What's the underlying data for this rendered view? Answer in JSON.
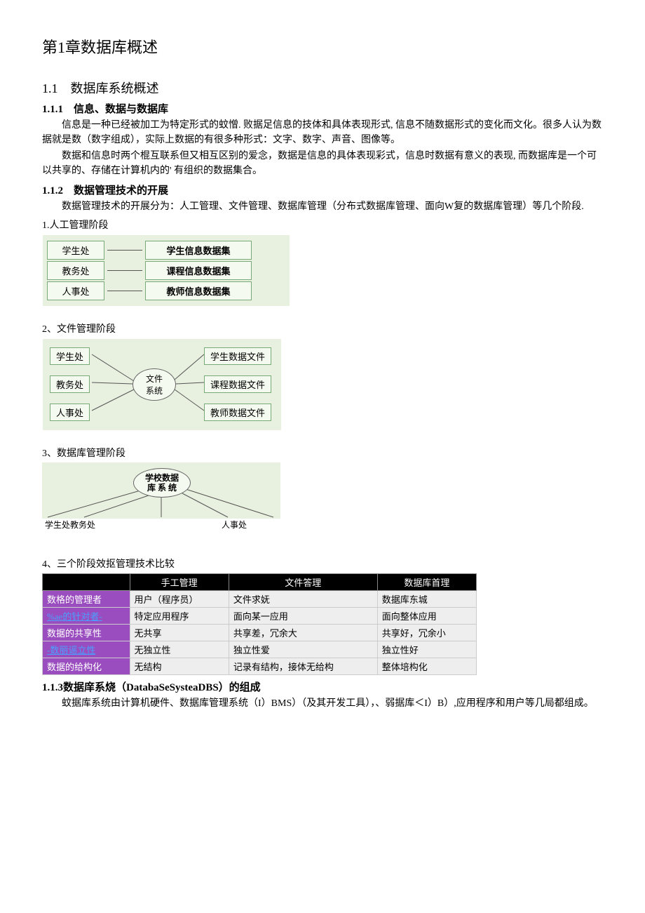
{
  "chapter": "第1章数据库概述",
  "sec1_1": "1.1　数据库系统概述",
  "sec1_1_1": "1.1.1　信息、数据与数据库",
  "p1": "信息是一种已经被加工为特定形式的蚊憎. 败据足信息的技体和具体表现形式, 信息不随数据形式的变化而文化。很多人认为数据就是数（数字组成），实际上数据的有很多种形式：文字、数字、声音、图像等。",
  "p2": "数据和信息时两个棍互联系但又相互区别的爱念，数据是信息的具体表现彩式，信息时数据有意义的表现, 而数据库是一个可以共享的、存储在计算机内的' 有组织的数据集合。",
  "sec1_1_2": "1.1.2　数据管理技术的开展",
  "p3": "数据管理技术的开展分为：人工管理、文件管理、数据库管理（分布式数据库管理、面向W复的数据库管理）等几个阶段.",
  "stage1": "1.人工管理阶段",
  "diag1": {
    "rows": [
      {
        "left": "学生处",
        "right": "学生信息数据集"
      },
      {
        "left": "教务处",
        "right": "课程信息数据集"
      },
      {
        "left": "人事处",
        "right": "教师信息数据集"
      }
    ]
  },
  "stage2": "2、文件管理阶段",
  "diag2": {
    "left": [
      "学生处",
      "教务处",
      "人事处"
    ],
    "center": "文件\n系统",
    "right": [
      "学生数据文件",
      "课程数据文件",
      "教师数据文件"
    ]
  },
  "stage3": "3、数据库管理阶段",
  "diag3": {
    "center": "学校数据\n库 系 统",
    "labels_left": "学生处教务处",
    "labels_right": "人事处"
  },
  "stage4": "4、三个阶段效抠管理技术比较",
  "table": {
    "headers": [
      "",
      "手工管理",
      "文件答理",
      "数据库首理"
    ],
    "rows": [
      [
        "数格的管理者",
        "用户（程序员）",
        "文件求妩",
        "数据库东城"
      ],
      [
        "%ae的针对者-",
        "特定应用程序",
        "面向某一应用",
        "面向整体应用"
      ],
      [
        "数据的共享性",
        "无共享",
        "共享差，冗余大",
        "共享好，冗余小"
      ],
      [
        "-数丽谣立性",
        "无独立性",
        "独立性爱",
        "独立性好"
      ],
      [
        "数据的给构化",
        "无结构",
        "记录有结构，接体无给构",
        "整体培构化"
      ]
    ],
    "link_rows": [
      1,
      3
    ]
  },
  "sec1_1_3": "1.1.3数据庠系烧（DatabaSeSysteaDBS）的组成",
  "p4": "蚊据库系统由计算机硬件、数据库管理系统（I）BMS）（及其开发工具），、弱据库＜I）B）,应用程序和用户等几局都组成。"
}
